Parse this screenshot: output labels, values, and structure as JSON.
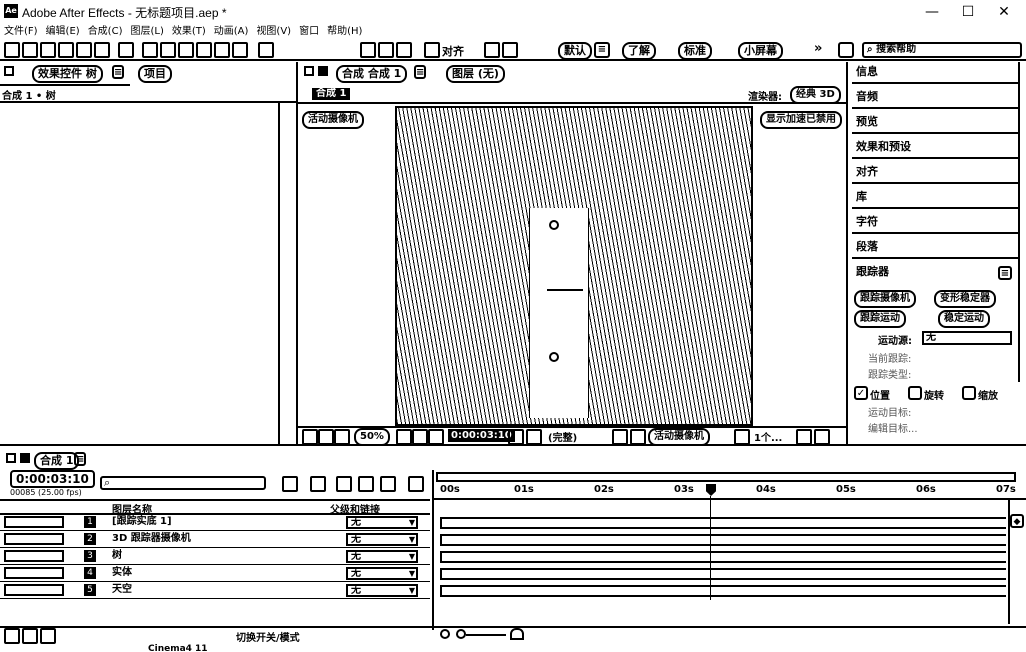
{
  "window": {
    "title": "Adobe After Effects - 无标题项目.aep *",
    "min": "—",
    "max": "☐",
    "close": "✕"
  },
  "menu": [
    "文件(F)",
    "编辑(E)",
    "合成(C)",
    "图层(L)",
    "效果(T)",
    "动画(A)",
    "视图(V)",
    "窗口",
    "帮助(H)"
  ],
  "toolbar": {
    "align_label": "对齐",
    "workspaces": [
      "默认",
      "了解",
      "标准",
      "小屏幕"
    ],
    "search_placeholder": "搜索帮助"
  },
  "left_panel": {
    "tabs": [
      "效果控件 树",
      "项目"
    ],
    "sub": "合成 1 • 树"
  },
  "viewer": {
    "tab": "合成 合成 1",
    "layer_tab": "图层 (无)",
    "comp_chip": "合成 1",
    "renderer_label": "渲染器:",
    "renderer_value": "经典 3D",
    "active_camera": "活动摄像机",
    "gpu_notice": "显示加速已禁用",
    "footer": {
      "zoom": "50%",
      "time": "0:00:03:10",
      "quality": "(完整)",
      "camera": "活动摄像机",
      "views": "1个..."
    }
  },
  "right_panel": {
    "items": [
      "信息",
      "音频",
      "预览",
      "效果和预设",
      "对齐",
      "库",
      "字符",
      "段落"
    ],
    "tracker": {
      "title": "跟踪器",
      "buttons": [
        "跟踪摄像机",
        "变形稳定器",
        "跟踪运动",
        "稳定运动"
      ],
      "motion_source_label": "运动源:",
      "motion_source_value": "无",
      "current_track_label": "当前跟踪:",
      "track_type_label": "跟踪类型:",
      "checks": [
        "位置",
        "旋转",
        "缩放"
      ],
      "motion_target_label": "运动目标:",
      "edit_target": "编辑目标..."
    }
  },
  "timeline": {
    "tab": "合成 1",
    "timecode": "0:00:03:10",
    "frame_info": "00085 (25.00 fps)",
    "col_layer_name": "图层名称",
    "col_parent": "父级和链接",
    "ruler": [
      "00s",
      "01s",
      "02s",
      "03s",
      "04s",
      "05s",
      "06s",
      "07s"
    ],
    "layers": [
      {
        "num": "1",
        "name": "[跟踪实底 1]",
        "parent": "无"
      },
      {
        "num": "2",
        "name": "3D 跟踪器摄像机",
        "parent": "无"
      },
      {
        "num": "3",
        "name": "树",
        "parent": "无"
      },
      {
        "num": "4",
        "name": "实体",
        "parent": "无"
      },
      {
        "num": "5",
        "name": "天空",
        "parent": "无"
      }
    ],
    "footer_toggle": "切换开关/模式"
  },
  "taskbar": {
    "item": "Cinema4 11"
  }
}
